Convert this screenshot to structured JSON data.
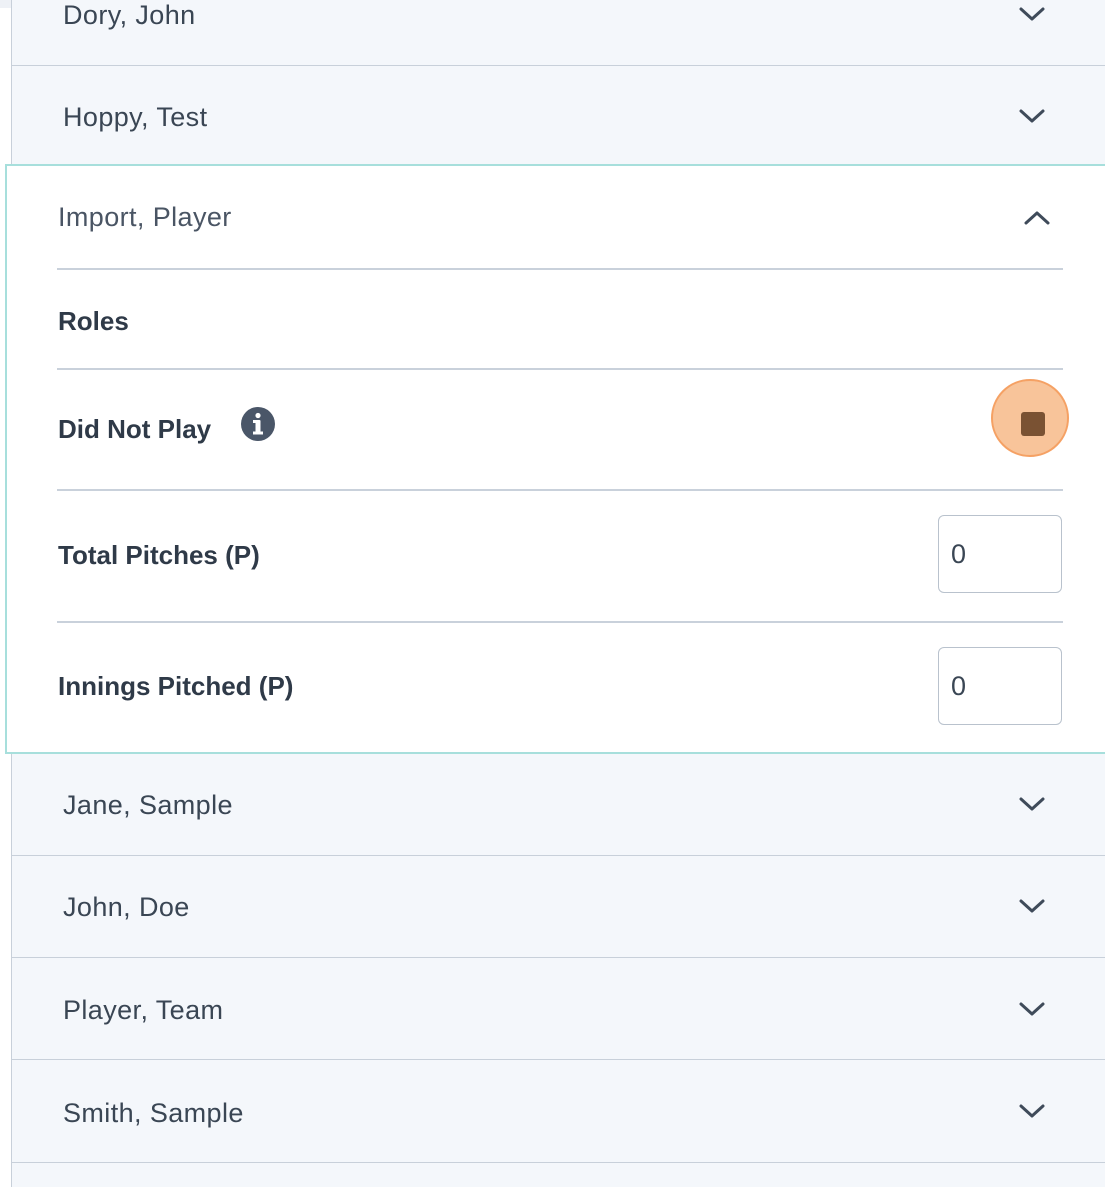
{
  "players_above": [
    {
      "name": "Dory, John"
    },
    {
      "name": "Hoppy, Test"
    }
  ],
  "expanded_player": {
    "name": "Import, Player",
    "roles_label": "Roles",
    "did_not_play_label": "Did Not Play",
    "did_not_play_checked": true,
    "total_pitches_label": "Total Pitches (P)",
    "total_pitches_value": "0",
    "innings_pitched_label": "Innings Pitched (P)",
    "innings_pitched_value": "0"
  },
  "players_below": [
    {
      "name": "Jane, Sample"
    },
    {
      "name": "John, Doe"
    },
    {
      "name": "Player, Team"
    },
    {
      "name": "Smith, Sample"
    }
  ],
  "colors": {
    "accent_border": "#a7dfdc",
    "checkbox_highlight": "#f8c49a",
    "checkbox_fill": "#7a5233",
    "row_background": "#f4f7fb"
  }
}
